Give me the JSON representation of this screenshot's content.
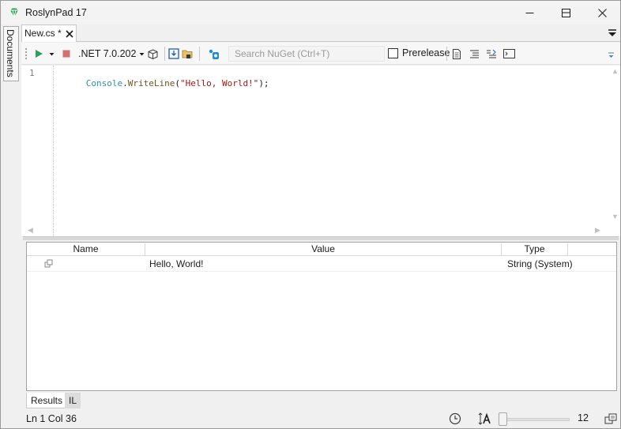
{
  "window": {
    "title": "RoslynPad 17",
    "accent": "#2e9e5a"
  },
  "side_panel": {
    "documents_label": "Documents"
  },
  "tabs": [
    {
      "label": "New.cs *"
    }
  ],
  "toolbar": {
    "sdk_label": ".NET 7.0.202",
    "search_placeholder": "Search NuGet (Ctrl+T)",
    "search_value": "",
    "prerelease_label": "Prerelease",
    "prerelease_checked": false
  },
  "editor": {
    "line_numbers": [
      "1"
    ],
    "code": {
      "type": "Console",
      "dot": ".",
      "method": "WriteLine",
      "open": "(",
      "string": "\"Hello, World!\"",
      "close": ");"
    },
    "colors": {
      "type": "#2b91af",
      "method": "#74531f",
      "string": "#a31515"
    }
  },
  "results": {
    "columns": [
      "Name",
      "Value",
      "Type"
    ],
    "rows": [
      {
        "name": "",
        "value": "Hello, World!",
        "type": "String (System)"
      }
    ]
  },
  "bottom_tabs": [
    "Results",
    "IL"
  ],
  "status": {
    "position": "Ln 1 Col 36",
    "zoom": "12"
  }
}
